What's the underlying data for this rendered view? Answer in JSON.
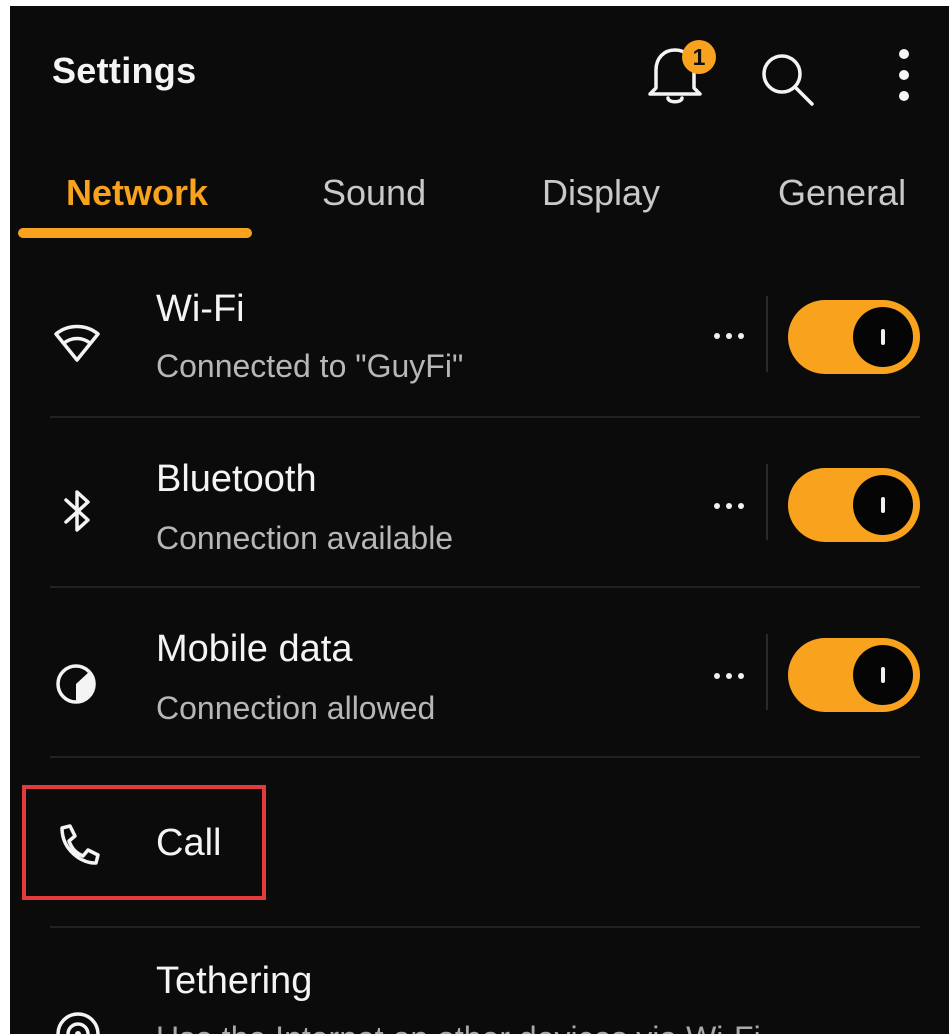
{
  "header": {
    "title": "Settings",
    "notification_count": "1",
    "icons": {
      "notifications": "bell-icon",
      "search": "search-icon",
      "more": "more-vertical-icon"
    }
  },
  "tabs": [
    {
      "label": "Network",
      "active": true
    },
    {
      "label": "Sound",
      "active": false
    },
    {
      "label": "Display",
      "active": false
    },
    {
      "label": "General",
      "active": false
    }
  ],
  "settings": [
    {
      "title": "Wi-Fi",
      "subtitle": "Connected to \"GuyFi\"",
      "icon": "wifi-icon",
      "toggle_on": true,
      "has_more": true
    },
    {
      "title": "Bluetooth",
      "subtitle": "Connection available",
      "icon": "bluetooth-icon",
      "toggle_on": true,
      "has_more": true
    },
    {
      "title": "Mobile data",
      "subtitle": "Connection allowed",
      "icon": "mobile-data-icon",
      "toggle_on": true,
      "has_more": true
    },
    {
      "title": "Call",
      "subtitle": "",
      "icon": "phone-icon",
      "toggle_on": false,
      "has_more": false,
      "highlighted": true
    },
    {
      "title": "Tethering",
      "subtitle": "Use the Internet on other devices via Wi-Fi",
      "icon": "tethering-icon",
      "toggle_on": false,
      "has_more": false
    }
  ],
  "colors": {
    "accent": "#f8a21d",
    "background": "#0b0b0b",
    "highlight": "#e33b3b"
  }
}
